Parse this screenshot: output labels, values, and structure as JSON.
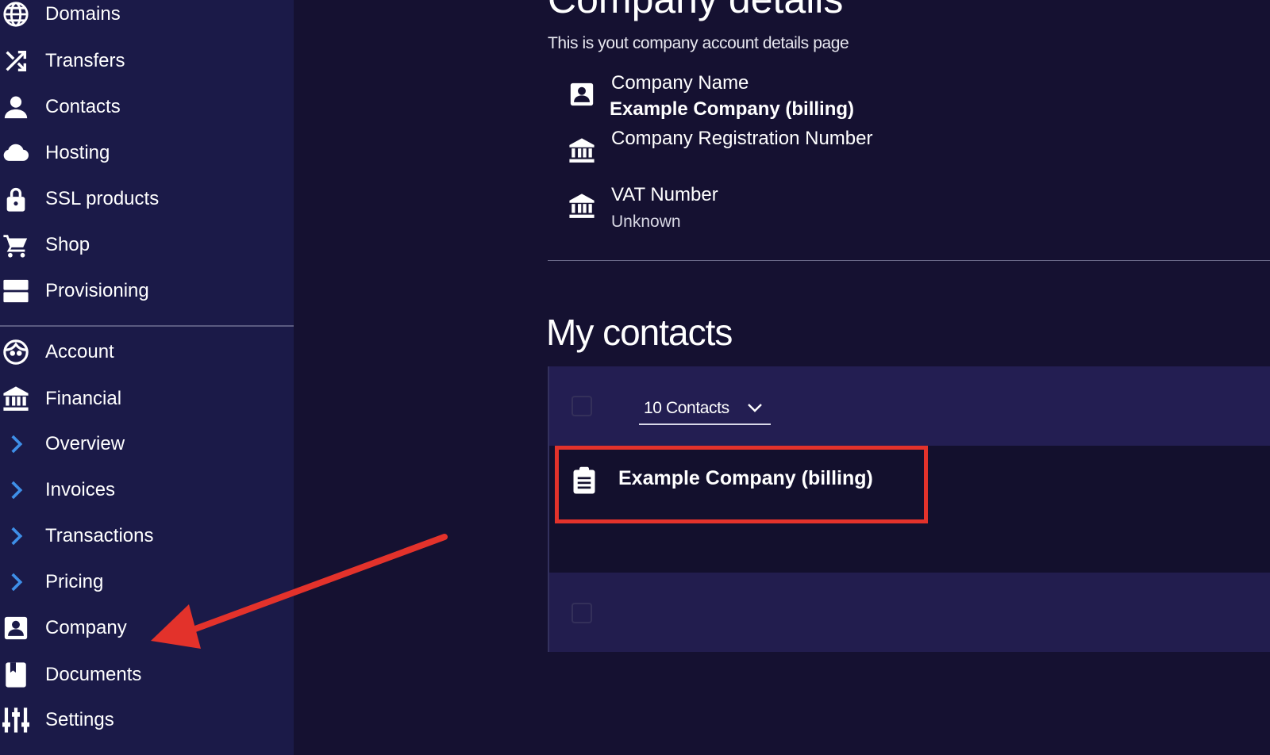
{
  "sidebar": {
    "items": [
      {
        "label": "Domains",
        "icon": "globe-icon"
      },
      {
        "label": "Transfers",
        "icon": "shuffle-icon"
      },
      {
        "label": "Contacts",
        "icon": "person-icon"
      },
      {
        "label": "Hosting",
        "icon": "cloud-icon"
      },
      {
        "label": "SSL products",
        "icon": "lock-icon"
      },
      {
        "label": "Shop",
        "icon": "cart-icon"
      },
      {
        "label": "Provisioning",
        "icon": "server-icon"
      },
      {
        "label": "Account",
        "icon": "face-icon"
      },
      {
        "label": "Financial",
        "icon": "bank-icon"
      },
      {
        "label": "Overview",
        "icon": "chevron-right-icon"
      },
      {
        "label": "Invoices",
        "icon": "chevron-right-icon"
      },
      {
        "label": "Transactions",
        "icon": "chevron-right-icon"
      },
      {
        "label": "Pricing",
        "icon": "chevron-right-icon"
      },
      {
        "label": "Company",
        "icon": "contact-card-icon"
      },
      {
        "label": "Documents",
        "icon": "book-icon"
      },
      {
        "label": "Settings",
        "icon": "sliders-icon"
      }
    ]
  },
  "main": {
    "title": "Company details",
    "subtitle": "This is yout company account details page",
    "details": [
      {
        "label": "Company Name",
        "value": "Example Company (billing)"
      },
      {
        "label": "Company Registration Number",
        "value": ""
      },
      {
        "label": "VAT Number",
        "value": "Unknown"
      }
    ],
    "contacts": {
      "title": "My contacts",
      "page_size_label": "10 Contacts",
      "rows": [
        {
          "name": "Example Company (billing)"
        }
      ]
    }
  },
  "colors": {
    "sidebar_bg": "#1b1a48",
    "main_bg": "#151131",
    "accent_chevron": "#3e8fe8",
    "annotation_red": "#e3322b"
  }
}
